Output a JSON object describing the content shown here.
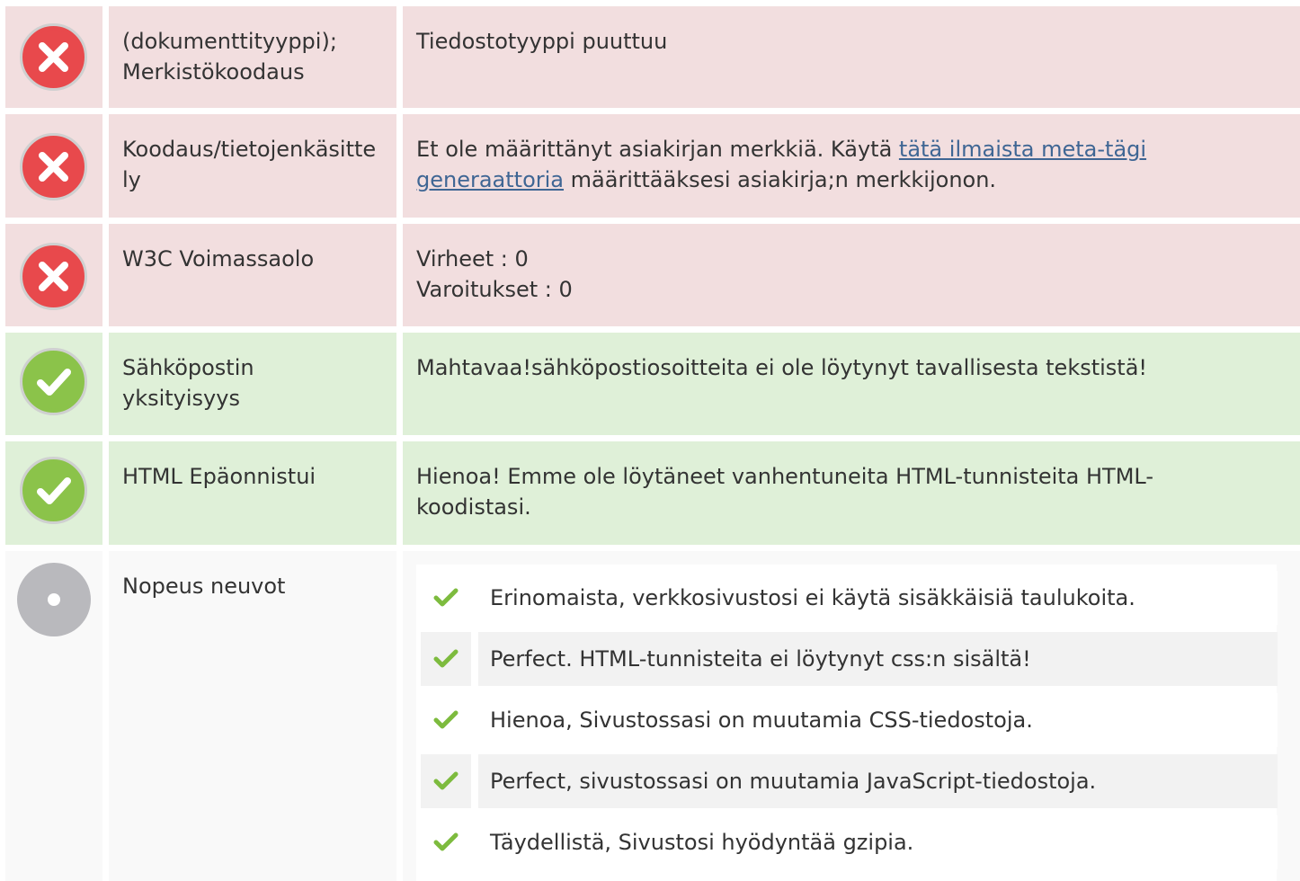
{
  "colors": {
    "error_bg": "#f2dedf",
    "ok_bg": "#dff0d8",
    "info_bg": "#f9f9f9",
    "error_icon": "#e8494c",
    "ok_icon": "#8bc34a",
    "info_icon": "#b9b9bd",
    "link": "#3f6694",
    "check": "#7dbb3e"
  },
  "rows": [
    {
      "status": "error",
      "status_icon": "error-x-icon",
      "label": "(dokumenttityyppi); Merkistökoodaus",
      "description": "Tiedostotyyppi puuttuu"
    },
    {
      "status": "error",
      "status_icon": "error-x-icon",
      "label": "Koodaus/tietojenkäsittely",
      "description_prefix": "Et ole määrittänyt asiakirjan merkkiä. Käytä ",
      "description_link": "tätä ilmaista meta-tägi generaattoria",
      "description_suffix": " määrittääksesi asiakirja;n merkkijonon."
    },
    {
      "status": "error",
      "status_icon": "error-x-icon",
      "label": "W3C Voimassaolo",
      "errors_line": "Virheet : 0",
      "warnings_line": "Varoitukset : 0"
    },
    {
      "status": "ok",
      "status_icon": "ok-check-icon",
      "label": "Sähköpostin yksityisyys",
      "description": "Mahtavaa!sähköpostiosoitteita ei ole löytynyt tavallisesta tekstistä!"
    },
    {
      "status": "ok",
      "status_icon": "ok-check-icon",
      "label": "HTML Epäonnistui",
      "description": "Hienoa! Emme ole löytäneet vanhentuneita HTML-tunnisteita HTML-koodistasi."
    },
    {
      "status": "info",
      "status_icon": "info-dot-icon",
      "label": "Nopeus neuvot",
      "speed_items": [
        "Erinomaista, verkkosivustosi ei käytä sisäkkäisiä taulukoita.",
        "Perfect. HTML-tunnisteita ei löytynyt css:n sisältä!",
        "Hienoa, Sivustossasi on muutamia CSS-tiedostoja.",
        "Perfect, sivustossasi on muutamia JavaScript-tiedostoja.",
        "Täydellistä, Sivustosi hyödyntää gzipia."
      ]
    }
  ]
}
